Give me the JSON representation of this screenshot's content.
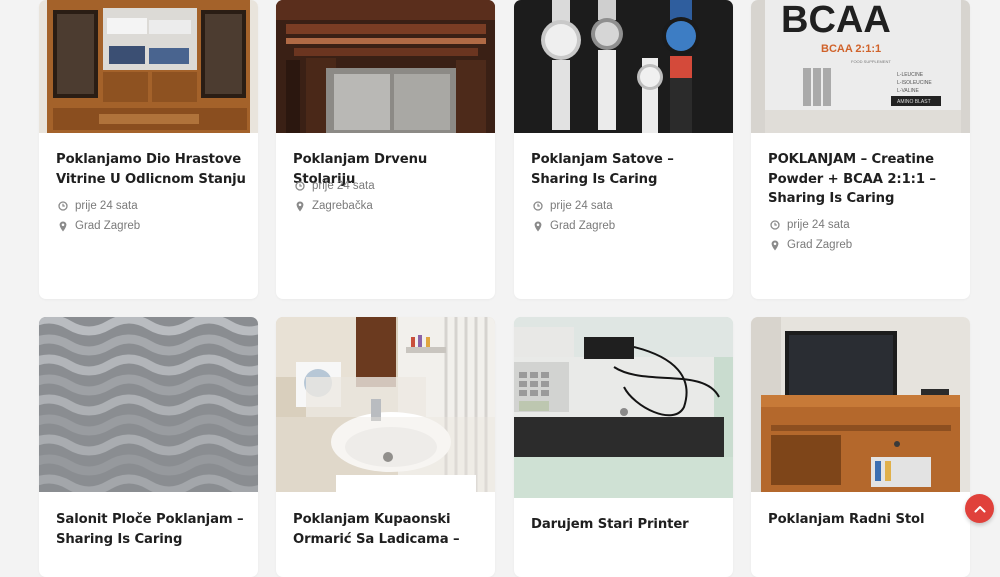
{
  "listings": [
    {
      "title": "Poklanjamo Dio Hrastove Vitrine U Odlicnom Stanju",
      "time": "prije 24 sata",
      "location": "Grad Zagreb"
    },
    {
      "title": "Poklanjam Drvenu Stolariju",
      "time": "prije 24 sata",
      "location": "Zagrebačka"
    },
    {
      "title": "Poklanjam Satove – Sharing Is Caring",
      "time": "prije 24 sata",
      "location": "Grad Zagreb"
    },
    {
      "title": "POKLANJAM – Creatine Powder + BCAA 2:1:1 – Sharing Is Caring",
      "time": "prije 24 sata",
      "location": "Grad Zagreb"
    },
    {
      "title": "Salonit Ploče Poklanjam – Sharing Is Caring"
    },
    {
      "title": "Poklanjam Kupaonski Ormarić Sa Ladicama –"
    },
    {
      "title": "Darujem Stari Printer"
    },
    {
      "title": "Poklanjam Radni Stol"
    }
  ],
  "image_text": {
    "bcaa_brand": "BCAA",
    "bcaa_ratio": "BCAA 2:1:1",
    "bcaa_sub": "FOOD SUPPLEMENT",
    "bcaa_lines": [
      "L-LEUCINE",
      "L-ISOLEUCINE",
      "L-VALINE"
    ],
    "bcaa_footer": "AMINO BLAST"
  },
  "icons": {
    "time": "clock-icon",
    "location": "map-pin-icon",
    "scroll_top": "chevron-up-icon"
  },
  "colors": {
    "accent": "#e0413b",
    "title": "#1f1f1f",
    "meta": "#7a7a7a",
    "background": "#f3f3f3"
  }
}
